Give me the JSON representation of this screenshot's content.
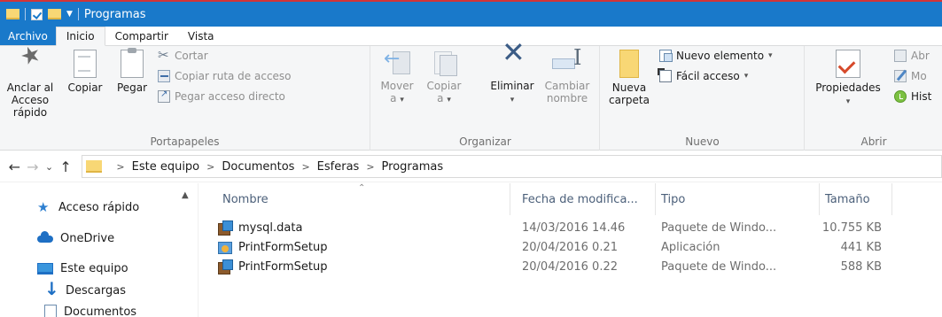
{
  "window": {
    "title": "Programas"
  },
  "ribbon_tabs": [
    "Archivo",
    "Inicio",
    "Compartir",
    "Vista"
  ],
  "ribbon": {
    "portapapeles": {
      "label": "Portapapeles",
      "pin": "Anclar al\nAcceso rápido",
      "copy": "Copiar",
      "paste": "Pegar",
      "cut": "Cortar",
      "copy_path": "Copiar ruta de acceso",
      "paste_shortcut": "Pegar acceso directo"
    },
    "organizar": {
      "label": "Organizar",
      "move": "Mover",
      "move_sub": "a",
      "copy_to": "Copiar",
      "copy_to_sub": "a",
      "delete": "Eliminar",
      "rename": "Cambiar",
      "rename_sub": "nombre"
    },
    "nuevo": {
      "label": "Nuevo",
      "new_folder": "Nueva",
      "new_folder_sub": "carpeta",
      "new_item": "Nuevo elemento",
      "easy_access": "Fácil acceso"
    },
    "abrir": {
      "label": "Abrir",
      "properties": "Propiedades",
      "open": "Abr",
      "edit": "Mo",
      "history": "Hist"
    }
  },
  "breadcrumb": [
    "Este equipo",
    "Documentos",
    "Esferas",
    "Programas"
  ],
  "nav_pane": [
    {
      "label": "Acceso rápido",
      "icon": "star-icon"
    },
    {
      "label": "OneDrive",
      "icon": "cloud-icon"
    },
    {
      "label": "Este equipo",
      "icon": "computer-icon"
    },
    {
      "label": "Descargas",
      "icon": "download-icon"
    },
    {
      "label": "Documentos",
      "icon": "documents-icon"
    }
  ],
  "columns": {
    "name": "Nombre",
    "date": "Fecha de modifica...",
    "type": "Tipo",
    "size": "Tamaño"
  },
  "files": [
    {
      "name": "mysql.data",
      "date": "14/03/2016 14.46",
      "type": "Paquete de Windo...",
      "size": "10.755 KB",
      "icon": "msi-package-icon"
    },
    {
      "name": "PrintFormSetup",
      "date": "20/04/2016 0.21",
      "type": "Aplicación",
      "size": "441 KB",
      "icon": "setup-application-icon"
    },
    {
      "name": "PrintFormSetup",
      "date": "20/04/2016 0.22",
      "type": "Paquete de Windo...",
      "size": "588 KB",
      "icon": "msi-package-icon"
    }
  ]
}
